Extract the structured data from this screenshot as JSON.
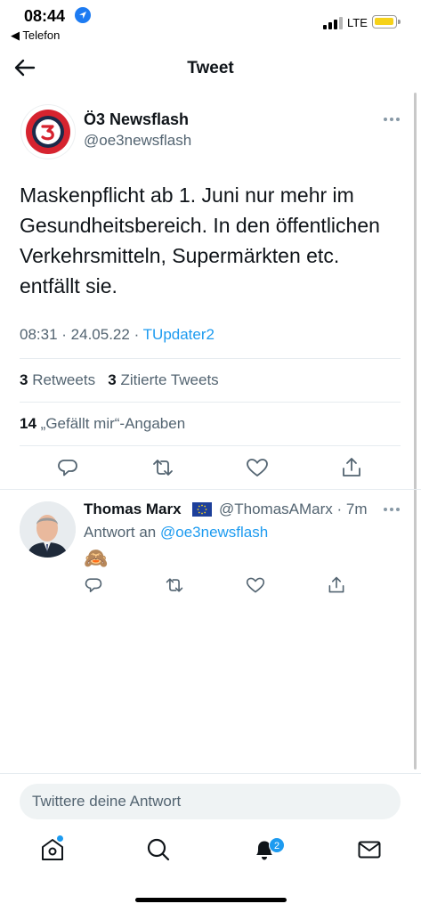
{
  "status_bar": {
    "time": "08:44",
    "back_app": "◀ Telefon",
    "network": "LTE"
  },
  "nav": {
    "title": "Tweet"
  },
  "tweet": {
    "author_name": "Ö3 Newsflash",
    "author_handle": "@oe3newsflash",
    "text": "Maskenpflicht ab 1. Juni nur mehr im Gesundheitsbereich. In den öffentlichen Verkehrsmitteln, Supermärkten etc. entfällt sie.",
    "time": "08:31",
    "date": "24.05.22",
    "source": "TUpdater2",
    "retweets_count": "3",
    "retweets_label": "Retweets",
    "quotes_count": "3",
    "quotes_label": "Zitierte Tweets",
    "likes_count": "14",
    "likes_label": "„Gefällt mir“-Angaben"
  },
  "reply": {
    "author_name": "Thomas Marx",
    "author_handle": "@ThomasAMarx",
    "age": "7m",
    "reply_prefix": "Antwort an",
    "reply_mention": "@oe3newsflash",
    "text": "🙈"
  },
  "compose": {
    "placeholder": "Twittere deine Antwort"
  },
  "tabbar": {
    "notifications_badge": "2"
  },
  "colors": {
    "accent": "#1d9bf0",
    "secondary_text": "#536471",
    "brand_red": "#d6232f",
    "brand_navy": "#1b2a4a"
  },
  "icons": [
    "back-arrow-icon",
    "more-icon",
    "reply-icon",
    "retweet-icon",
    "like-icon",
    "share-icon",
    "home-icon",
    "search-icon",
    "bell-icon",
    "mail-icon",
    "location-arrow-icon"
  ]
}
